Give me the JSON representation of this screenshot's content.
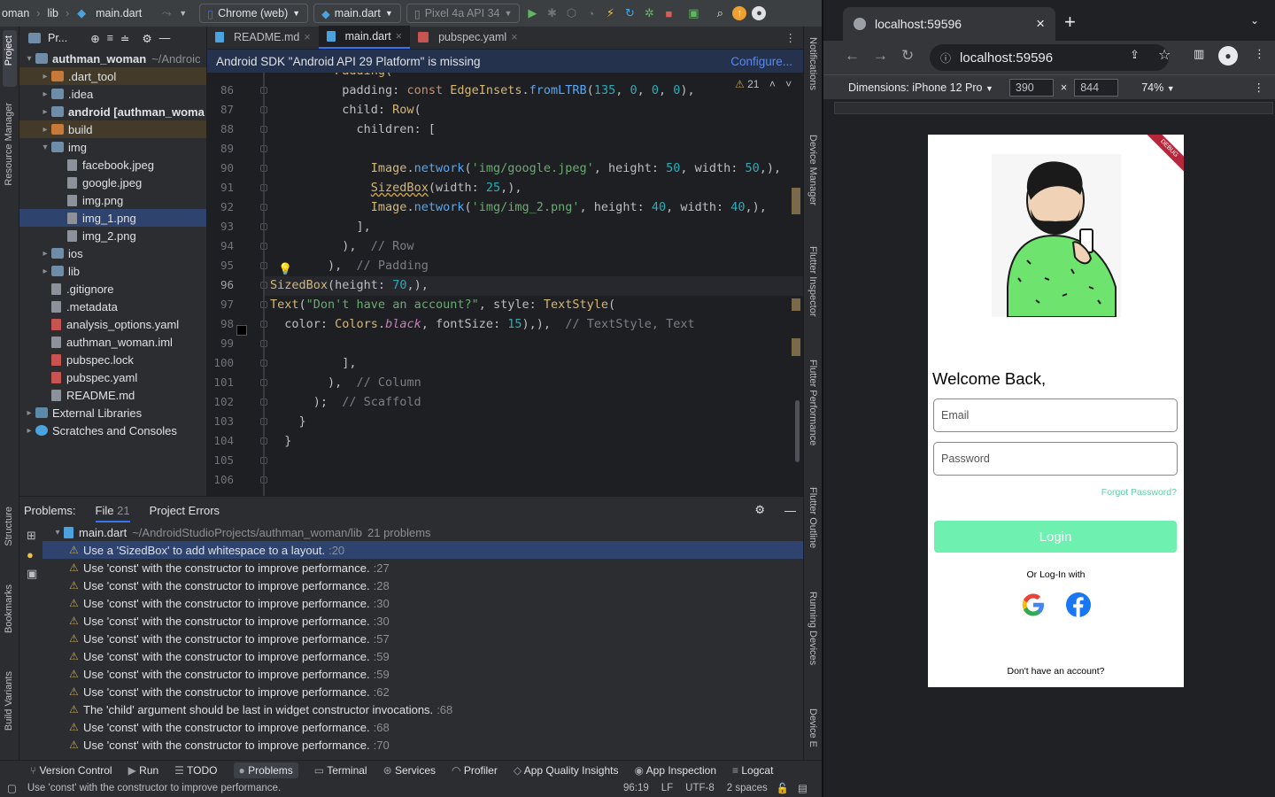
{
  "ide": {
    "breadcrumbs": [
      "oman",
      "lib",
      "main.dart"
    ],
    "device_target": "Chrome (web)",
    "run_config": "main.dart",
    "emulator": "Pixel 4a API 34",
    "project_title": "Pr...",
    "tabs": [
      {
        "label": "README.md",
        "active": false
      },
      {
        "label": "main.dart",
        "active": true
      },
      {
        "label": "pubspec.yaml",
        "active": false
      }
    ],
    "banner": {
      "text": "Android SDK \"Android API 29 Platform\" is missing",
      "action": "Configure..."
    },
    "warning_count": "21",
    "tree": [
      {
        "label": "authman_woman",
        "suffix": "~/Androic",
        "depth": 0,
        "arrow": "down",
        "type": "folder",
        "bold": true
      },
      {
        "label": ".dart_tool",
        "depth": 1,
        "arrow": "right",
        "type": "folder-orange",
        "hl": true
      },
      {
        "label": ".idea",
        "depth": 1,
        "arrow": "right",
        "type": "folder"
      },
      {
        "label": "android [authman_woma",
        "depth": 1,
        "arrow": "right",
        "type": "folder",
        "bold": true
      },
      {
        "label": "build",
        "depth": 1,
        "arrow": "right",
        "type": "folder-orange",
        "hl": true
      },
      {
        "label": "img",
        "depth": 1,
        "arrow": "down",
        "type": "folder"
      },
      {
        "label": "facebook.jpeg",
        "depth": 2,
        "type": "file"
      },
      {
        "label": "google.jpeg",
        "depth": 2,
        "type": "file"
      },
      {
        "label": "img.png",
        "depth": 2,
        "type": "file"
      },
      {
        "label": "img_1.png",
        "depth": 2,
        "type": "file",
        "selected": true
      },
      {
        "label": "img_2.png",
        "depth": 2,
        "type": "file"
      },
      {
        "label": "ios",
        "depth": 1,
        "arrow": "right",
        "type": "folder"
      },
      {
        "label": "lib",
        "depth": 1,
        "arrow": "right",
        "type": "folder"
      },
      {
        "label": ".gitignore",
        "depth": 1,
        "type": "file"
      },
      {
        "label": ".metadata",
        "depth": 1,
        "type": "file"
      },
      {
        "label": "analysis_options.yaml",
        "depth": 1,
        "type": "file-yaml"
      },
      {
        "label": "authman_woman.iml",
        "depth": 1,
        "type": "file"
      },
      {
        "label": "pubspec.lock",
        "depth": 1,
        "type": "file-yaml"
      },
      {
        "label": "pubspec.yaml",
        "depth": 1,
        "type": "file-yaml"
      },
      {
        "label": "README.md",
        "depth": 1,
        "type": "file"
      },
      {
        "label": "External Libraries",
        "depth": 0,
        "arrow": "right",
        "type": "lib"
      },
      {
        "label": "Scratches and Consoles",
        "depth": 0,
        "arrow": "right",
        "type": "scratch"
      }
    ],
    "line_numbers": [
      "86",
      "87",
      "88",
      "89",
      "90",
      "91",
      "92",
      "93",
      "94",
      "95",
      "96",
      "97",
      "98",
      "99",
      "100",
      "101",
      "102",
      "103",
      "104",
      "105",
      "106"
    ],
    "current_line": "96",
    "problems": {
      "tabs": [
        "Problems:",
        "File",
        "21",
        "Project Errors"
      ],
      "file_header": "main.dart",
      "file_path": "~/AndroidStudioProjects/authman_woman/lib",
      "file_count": "21 problems",
      "items": [
        {
          "text": "Use a 'SizedBox' to add whitespace to a layout.",
          "line": ":20",
          "selected": true
        },
        {
          "text": "Use 'const' with the constructor to improve performance.",
          "line": ":27"
        },
        {
          "text": "Use 'const' with the constructor to improve performance.",
          "line": ":28"
        },
        {
          "text": "Use 'const' with the constructor to improve performance.",
          "line": ":30"
        },
        {
          "text": "Use 'const' with the constructor to improve performance.",
          "line": ":30"
        },
        {
          "text": "Use 'const' with the constructor to improve performance.",
          "line": ":57"
        },
        {
          "text": "Use 'const' with the constructor to improve performance.",
          "line": ":59"
        },
        {
          "text": "Use 'const' with the constructor to improve performance.",
          "line": ":59"
        },
        {
          "text": "Use 'const' with the constructor to improve performance.",
          "line": ":62"
        },
        {
          "text": "The 'child' argument should be last in widget constructor invocations.",
          "line": ":68"
        },
        {
          "text": "Use 'const' with the constructor to improve performance.",
          "line": ":68"
        },
        {
          "text": "Use 'const' with the constructor to improve performance.",
          "line": ":70"
        }
      ]
    },
    "toolwindows": [
      "Version Control",
      "Run",
      "TODO",
      "Problems",
      "Terminal",
      "Services",
      "Profiler",
      "App Quality Insights",
      "App Inspection",
      "Logcat"
    ],
    "active_toolwindow": "Problems",
    "status": {
      "message": "Use 'const' with the constructor to improve performance.",
      "position": "96:19",
      "line_sep": "LF",
      "encoding": "UTF-8",
      "indent": "2 spaces"
    },
    "left_labels": [
      "Project",
      "Resource Manager",
      "Structure",
      "Bookmarks",
      "Build Variants"
    ],
    "right_labels": [
      "Notifications",
      "Device Manager",
      "Flutter Inspector",
      "Flutter Performance",
      "Flutter Outline",
      "Running Devices",
      "Device E"
    ]
  },
  "browser": {
    "tab_title": "localhost:59596",
    "url": "localhost:59596",
    "device": "Dimensions: iPhone 12 Pro",
    "width": "390",
    "height": "844",
    "zoom": "74%",
    "app": {
      "debug_banner": "DEBUG",
      "welcome": "Welcome Back,",
      "email_placeholder": "Email",
      "password_placeholder": "Password",
      "forgot": "Forgot Password?",
      "login": "Login",
      "or_login": "Or Log-In with",
      "signup_prompt": "Don't have an account?"
    }
  }
}
